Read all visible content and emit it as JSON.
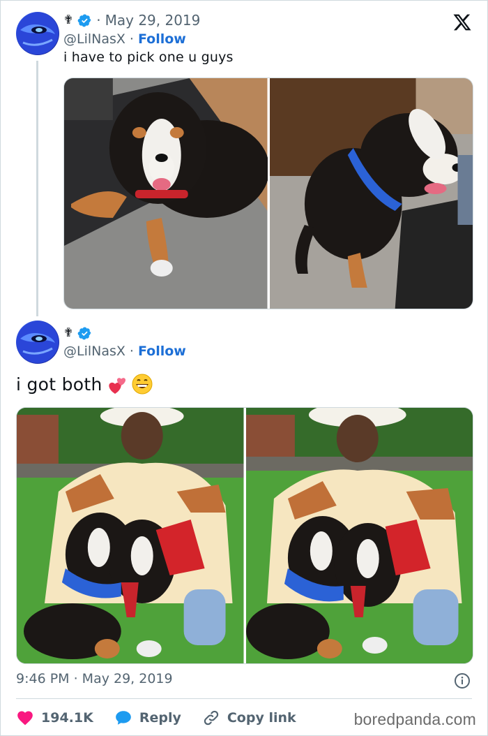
{
  "colors": {
    "accent": "#1d6fd6",
    "like": "#f91880",
    "muted": "#536471",
    "border": "#cfd9de"
  },
  "tweet1": {
    "cross": "✟",
    "date": "May 29, 2019",
    "handle": "@LilNasX",
    "separator": "·",
    "follow_label": "Follow",
    "text": "i have to pick one u guys",
    "media": [
      "puppy-on-mat-photo",
      "puppy-blue-harness-photo"
    ]
  },
  "tweet2": {
    "cross": "✟",
    "handle": "@LilNasX",
    "separator": "·",
    "follow_label": "Follow",
    "text": "i got both",
    "media": [
      "man-with-two-puppies-photo",
      "man-with-two-puppies-photo-2"
    ],
    "timestamp": "9:46 PM · May 29, 2019"
  },
  "actions": {
    "likes": "194.1K",
    "reply_label": "Reply",
    "copy_label": "Copy link"
  },
  "watermark": "boredpanda.com"
}
